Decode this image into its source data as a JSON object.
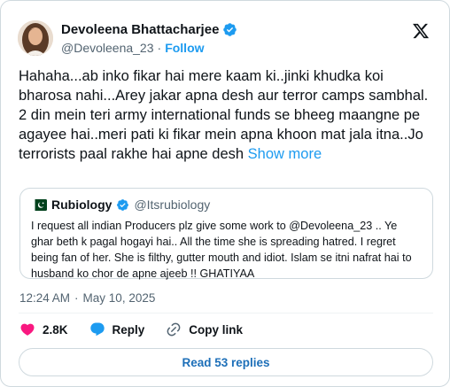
{
  "author": {
    "display_name": "Devoleena Bhattacharjee",
    "handle": "@Devoleena_23",
    "separator": "·",
    "follow_label": "Follow"
  },
  "tweet": {
    "text": "Hahaha...ab inko fikar hai mere kaam ki..jinki khudka koi bharosa nahi...Arey jakar apna desh aur terror camps sambhal. 2 din mein teri army international funds se bheeg maangne pe agayee hai..meri pati ki fikar mein apna khoon mat jala itna..Jo terrorists paal rakhe hai apne desh",
    "show_more": "Show more"
  },
  "quote": {
    "display_name": "Rubiology",
    "handle": "@Itsrubiology",
    "text": "I request all indian Producers plz give some work to @Devoleena_23 .. Ye ghar beth k pagal hogayi hai.. All the time she is spreading hatred. I regret being fan of her. She is filthy, gutter mouth and idiot. Islam se itni nafrat hai to husband ko chor de apne ajeeb !! GHATIYAA"
  },
  "timestamp": {
    "time": "12:24 AM",
    "separator": "·",
    "date": "May 10, 2025"
  },
  "actions": {
    "likes": "2.8K",
    "reply_label": "Reply",
    "copy_link_label": "Copy link"
  },
  "read_replies_label": "Read 53 replies",
  "colors": {
    "accent": "#1d9bf0",
    "like_red": "#f91880",
    "text_secondary": "#536471"
  },
  "icons": [
    "verified-badge-icon",
    "x-logo-icon",
    "pakistan-flag-icon",
    "heart-icon",
    "reply-bubble-icon",
    "link-icon"
  ]
}
